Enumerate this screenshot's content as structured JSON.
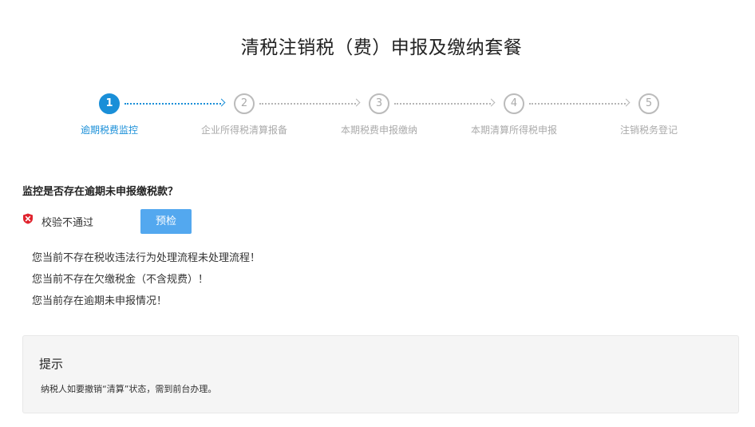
{
  "page": {
    "title": "清税注销税（费）申报及缴纳套餐"
  },
  "steps": [
    {
      "number": "1",
      "label": "逾期税费监控",
      "active": true
    },
    {
      "number": "2",
      "label": "企业所得税清算报备",
      "active": false
    },
    {
      "number": "3",
      "label": "本期税费申报缴纳",
      "active": false
    },
    {
      "number": "4",
      "label": "本期清算所得税申报",
      "active": false
    },
    {
      "number": "5",
      "label": "注销税务登记",
      "active": false
    }
  ],
  "monitor": {
    "question": "监控是否存在逾期未申报缴税款？",
    "status_text": "校验不通过",
    "status_icon": "error-shield-icon",
    "precheck_label": "预检",
    "messages": [
      "您当前不存在税收违法行为处理流程未处理流程！",
      "您当前不存在欠缴税金（不含规费）！",
      "您当前存在逾期未申报情况！"
    ]
  },
  "tip": {
    "title": "提示",
    "text": "纳税人如要撤销“清算”状态，需到前台办理。"
  },
  "colors": {
    "accent": "#1a8fd8",
    "button": "#53a8ef",
    "error": "#e0242e",
    "inactive": "#aaaaaa"
  }
}
